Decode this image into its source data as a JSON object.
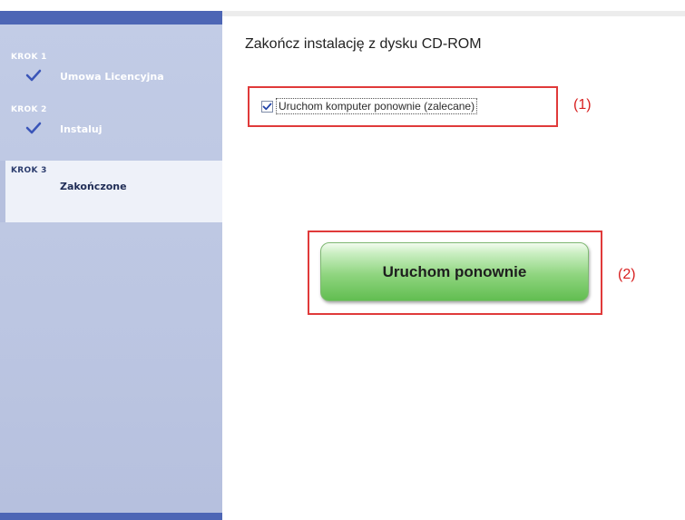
{
  "sidebar": {
    "steps": [
      {
        "label": "KROK 1",
        "title": "Umowa Licencyjna",
        "done": true
      },
      {
        "label": "KROK 2",
        "title": "Instaluj",
        "done": true
      },
      {
        "label": "KROK 3",
        "title": "Zakończone",
        "done": false
      }
    ]
  },
  "main": {
    "title": "Zakończ instalację z dysku CD-ROM",
    "checkbox": {
      "label": "Uruchom komputer ponownie (zalecane)",
      "checked": true
    },
    "restart_button_label": "Uruchom ponownie",
    "annotations": [
      "(1)",
      "(2)"
    ]
  },
  "colors": {
    "sidebar_bg": "#bcc6e2",
    "sidebar_accent": "#4d66b5",
    "annotation_red": "#e03a3a",
    "button_green": "#8fd57f"
  }
}
